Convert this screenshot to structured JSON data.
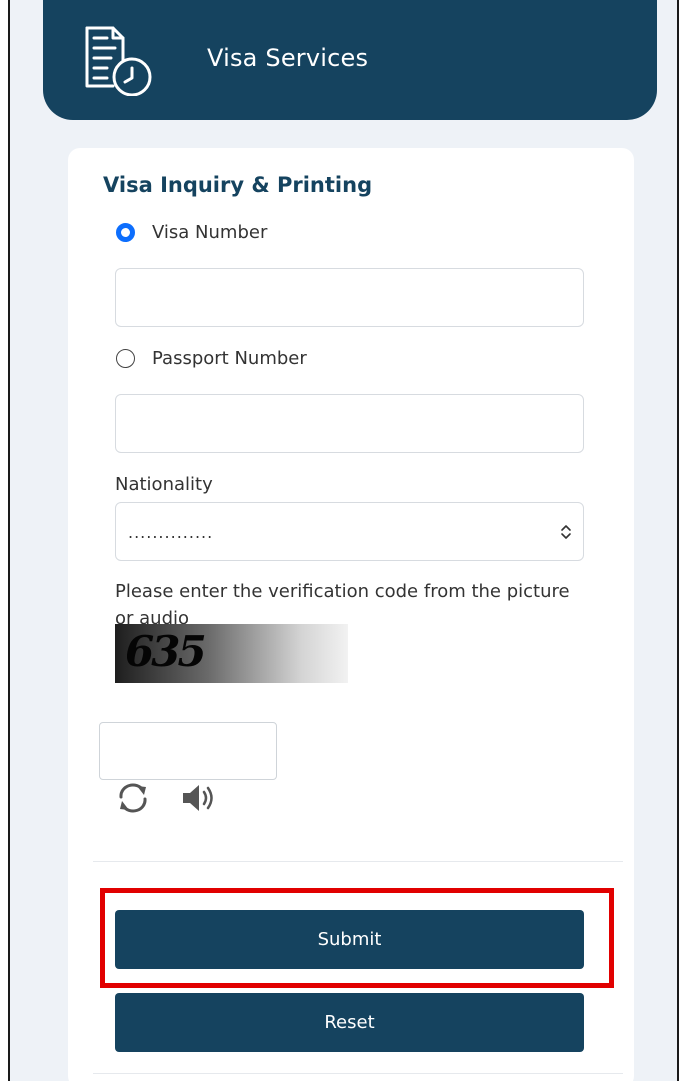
{
  "header": {
    "title": "Visa Services",
    "icon": "document-clock-icon",
    "color": "#15435f"
  },
  "form": {
    "section_title": "Visa Inquiry & Printing",
    "visa_number": {
      "label": "Visa Number",
      "selected": true,
      "value": ""
    },
    "passport_number": {
      "label": "Passport Number",
      "selected": false,
      "value": ""
    },
    "nationality": {
      "label": "Nationality",
      "selected_value": ".............."
    },
    "verification": {
      "hint": "Please enter the verification code from the picture or audio",
      "captcha_text": "635",
      "value": "",
      "refresh_icon": "refresh-icon",
      "audio_icon": "speaker-icon"
    },
    "submit_label": "Submit",
    "reset_label": "Reset"
  },
  "colors": {
    "primary": "#15435f",
    "radio_selected": "#0d6efd",
    "highlight": "#e10000"
  }
}
